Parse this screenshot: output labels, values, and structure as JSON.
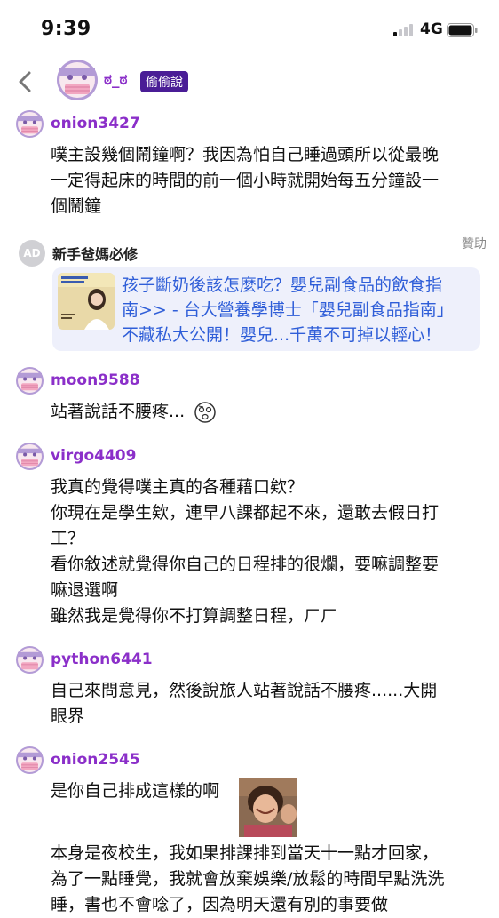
{
  "status_bar": {
    "time": "9:39",
    "network": "4G"
  },
  "nav": {
    "name": "ಠ_ಠ",
    "badge": "偷偷說"
  },
  "posts": [
    {
      "user": "onion3427",
      "lines": [
        "噗主設幾個鬧鐘啊？我因為怕自己睡過頭所以從最晚",
        "一定得起床的時間的前一個小時就開始每五分鐘設一",
        "個鬧鐘"
      ]
    },
    {
      "user": "moon9588",
      "lines": [
        "站著說話不腰疼..."
      ]
    },
    {
      "user": "virgo4409",
      "lines": [
        "我真的覺得噗主真的各種藉口欸？",
        "你現在是學生欸，連早八課都起不來，還敢去假日打",
        "工？",
        "看你敘述就覺得你自己的日程排的很爛，要嘛調整要",
        "嘛退選啊",
        "雖然我是覺得你不打算調整日程，ㄏㄏ"
      ]
    },
    {
      "user": "python6441",
      "lines": [
        "自己來問意見，然後說旅人站著說話不腰疼......大開",
        "眼界"
      ]
    },
    {
      "user": "onion2545",
      "lines": [
        "是你自己排成這樣的啊"
      ],
      "lines2": [
        "本身是夜校生，我如果排課排到當天十一點才回家，",
        "為了一點睡覺，我就會放棄娛樂/放鬆的時間早點洗洗",
        "睡，書也不會唸了，因為明天還有別的事要做"
      ]
    }
  ],
  "ad": {
    "badge": "AD",
    "title": "新手爸媽必修",
    "sponsor": "贊助",
    "lines": [
      "孩子斷奶後該怎麼吃？嬰兒副食品的飲食指",
      "南>> - 台大營養學博士「嬰兒副食品指南」",
      "不藏私大公開！嬰兒...千萬不可掉以輕心！"
    ]
  },
  "colors": {
    "username": "#8b2fc9",
    "badge_bg": "#4a1d96",
    "ad_link": "#2f5ed8",
    "ad_card_bg": "#eef0fb"
  }
}
